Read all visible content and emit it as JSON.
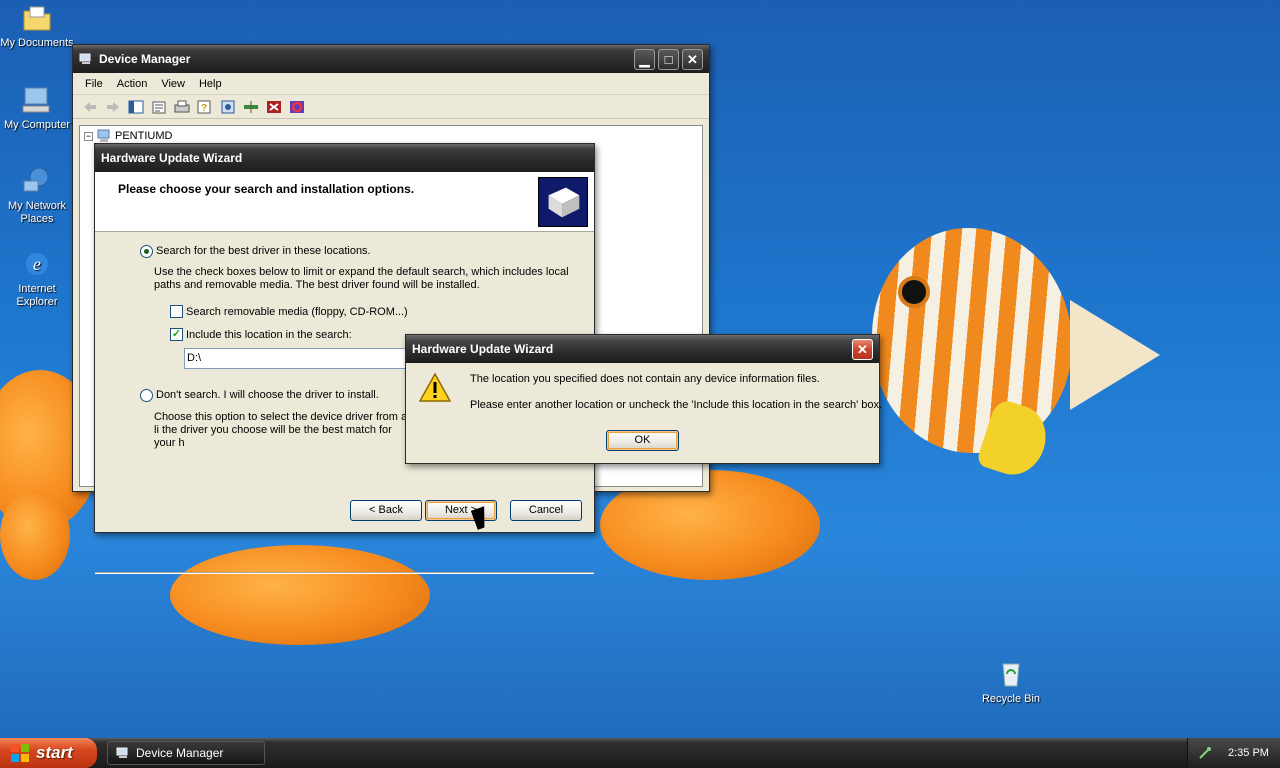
{
  "desktop": {
    "icons": [
      {
        "label": "My Documents"
      },
      {
        "label": "My Computer"
      },
      {
        "label": "My Network Places"
      },
      {
        "label": "Internet Explorer"
      },
      {
        "label": "Recycle Bin"
      }
    ]
  },
  "device_manager": {
    "title": "Device Manager",
    "menu": [
      "File",
      "Action",
      "View",
      "Help"
    ],
    "tree_root": "PENTIUMD",
    "title_buttons": {
      "minimize": "▁",
      "maximize": "□",
      "close": "✕"
    }
  },
  "wizard": {
    "title": "Hardware Update Wizard",
    "heading": "Please choose your search and installation options.",
    "option_search_label": "Search for the best driver in these locations.",
    "option_search_desc": "Use the check boxes below to limit or expand the default search, which includes local paths and removable media. The best driver found will be installed.",
    "check_removable_label": "Search removable media (floppy, CD-ROM...)",
    "check_location_label": "Include this location in the search:",
    "location_value": "D:\\",
    "option_dont_label": "Don't search. I will choose the driver to install.",
    "option_dont_desc": "Choose this option to select the device driver from a li the driver you choose will be the best match for your h",
    "back_label": "< Back",
    "next_label": "Next >",
    "cancel_label": "Cancel",
    "removable_checked": false,
    "location_checked": true
  },
  "error_dialog": {
    "title": "Hardware Update Wizard",
    "message_line1": "The location you specified does not contain any device information files.",
    "message_line2": "Please enter another location or uncheck the 'Include this location in the search' box.",
    "ok_label": "OK",
    "icon": "warning-icon",
    "close_glyph": "✕"
  },
  "taskbar": {
    "start_label": "start",
    "task_label": "Device Manager",
    "clock": "2:35 PM"
  },
  "colors": {
    "accent_close": "#c9432a",
    "start_button": "#d8461c",
    "desktop_blue": "#1f79d0"
  }
}
